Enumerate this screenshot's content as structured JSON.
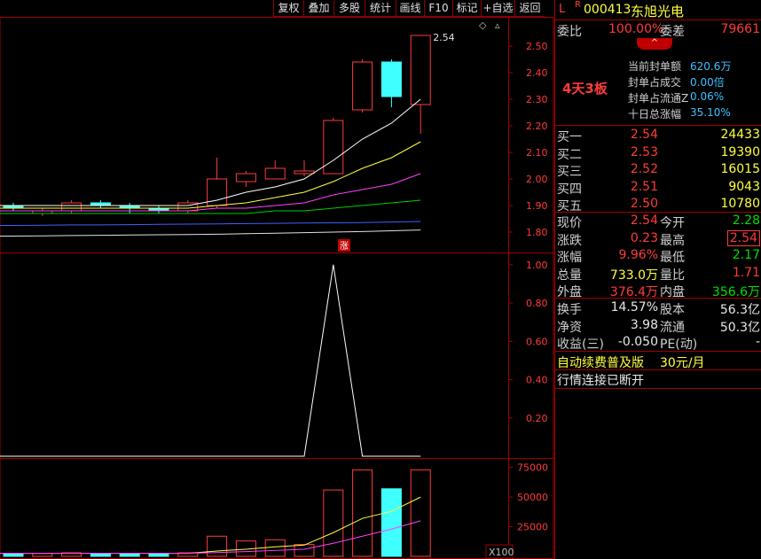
{
  "toolbar": {
    "items": [
      "复权",
      "叠加",
      "多股",
      "统计",
      "画线",
      "F10",
      "标记",
      "+自选",
      "返回"
    ]
  },
  "stock": {
    "flag1": "L",
    "flag2": "R",
    "code": "000413",
    "name": "东旭光电"
  },
  "weibi": {
    "label": "委比",
    "value": "100.00%",
    "label2": "委差",
    "value2": "79661"
  },
  "seal": {
    "badge": "4天3板",
    "rows": [
      {
        "label": "当前封单额",
        "value": "620.6万"
      },
      {
        "label": "封单占成交",
        "value": "0.00倍"
      },
      {
        "label": "封单占流通Z",
        "value": "0.06%"
      },
      {
        "label": "十日总涨幅",
        "value": "35.10%"
      }
    ]
  },
  "bids": [
    {
      "label": "买一",
      "price": "2.54",
      "vol": "24433"
    },
    {
      "label": "买二",
      "price": "2.53",
      "vol": "19390"
    },
    {
      "label": "买三",
      "price": "2.52",
      "vol": "16015"
    },
    {
      "label": "买四",
      "price": "2.51",
      "vol": "9043"
    },
    {
      "label": "买五",
      "price": "2.50",
      "vol": "10780"
    }
  ],
  "quote": [
    {
      "l1": "现价",
      "v1": "2.54",
      "c1": "red",
      "l2": "今开",
      "v2": "2.28",
      "c2": "green"
    },
    {
      "l1": "涨跌",
      "v1": "0.23",
      "c1": "red",
      "l2": "最高",
      "v2": "2.54",
      "c2": "red"
    },
    {
      "l1": "涨幅",
      "v1": "9.96%",
      "c1": "red",
      "l2": "最低",
      "v2": "2.17",
      "c2": "green"
    },
    {
      "l1": "总量",
      "v1": "733.0万",
      "c1": "yellow",
      "l2": "量比",
      "v2": "1.71",
      "c2": "red"
    },
    {
      "l1": "外盘",
      "v1": "376.4万",
      "c1": "red",
      "l2": "内盘",
      "v2": "356.6万",
      "c2": "green"
    }
  ],
  "fund": [
    {
      "l1": "换手",
      "v1": "14.57%",
      "l2": "股本",
      "v2": "56.3亿"
    },
    {
      "l1": "净资",
      "v1": "3.98",
      "l2": "流通",
      "v2": "50.3亿"
    },
    {
      "l1": "收益(三)",
      "v1": "-0.050",
      "l2": "PE(动)",
      "v2": "-"
    }
  ],
  "promo": {
    "text": "自动续费普及版",
    "price": "30元/月"
  },
  "status": {
    "text": "行情连接已断开"
  },
  "chart_labels": {
    "price_high": "2.54",
    "limit_up": "涨",
    "vol_unit": "X100"
  },
  "chart_data": [
    {
      "type": "candlestick",
      "ylim": [
        1.75,
        2.58
      ],
      "yticks": [
        "2.50",
        "2.40",
        "2.30",
        "2.20",
        "2.10",
        "2.00",
        "1.90",
        "1.80"
      ],
      "candles": [
        {
          "o": 1.9,
          "c": 1.89,
          "h": 1.91,
          "l": 1.88
        },
        {
          "o": 1.87,
          "c": 1.88,
          "h": 1.89,
          "l": 1.86
        },
        {
          "o": 1.88,
          "c": 1.91,
          "h": 1.92,
          "l": 1.87
        },
        {
          "o": 1.91,
          "c": 1.9,
          "h": 1.92,
          "l": 1.89
        },
        {
          "o": 1.9,
          "c": 1.89,
          "h": 1.91,
          "l": 1.87
        },
        {
          "o": 1.89,
          "c": 1.88,
          "h": 1.9,
          "l": 1.87
        },
        {
          "o": 1.88,
          "c": 1.91,
          "h": 1.92,
          "l": 1.87
        },
        {
          "o": 1.9,
          "c": 2.0,
          "h": 2.08,
          "l": 1.89
        },
        {
          "o": 1.99,
          "c": 2.02,
          "h": 2.03,
          "l": 1.97
        },
        {
          "o": 2.0,
          "c": 2.04,
          "h": 2.07,
          "l": 2.0
        },
        {
          "o": 2.02,
          "c": 2.03,
          "h": 2.07,
          "l": 2.01
        },
        {
          "o": 2.02,
          "c": 2.22,
          "h": 2.23,
          "l": 2.02
        },
        {
          "o": 2.26,
          "c": 2.44,
          "h": 2.45,
          "l": 2.25
        },
        {
          "o": 2.44,
          "c": 2.31,
          "h": 2.45,
          "l": 2.27
        },
        {
          "o": 2.28,
          "c": 2.54,
          "h": 2.54,
          "l": 2.17
        }
      ],
      "ma": [
        {
          "color": "#ffffff",
          "values": [
            1.9,
            1.9,
            1.9,
            1.9,
            1.9,
            1.9,
            1.9,
            1.92,
            1.95,
            1.97,
            2.0,
            2.07,
            2.15,
            2.21,
            2.3
          ]
        },
        {
          "color": "#ffff40",
          "values": [
            1.89,
            1.89,
            1.89,
            1.89,
            1.89,
            1.89,
            1.89,
            1.9,
            1.91,
            1.93,
            1.95,
            1.99,
            2.04,
            2.08,
            2.14
          ]
        },
        {
          "color": "#ff40ff",
          "values": [
            1.88,
            1.88,
            1.88,
            1.88,
            1.88,
            1.88,
            1.88,
            1.89,
            1.89,
            1.9,
            1.91,
            1.94,
            1.96,
            1.98,
            2.02
          ]
        },
        {
          "color": "#00d000",
          "values": [
            1.87,
            1.87,
            1.87,
            1.87,
            1.87,
            1.87,
            1.87,
            1.87,
            1.87,
            1.88,
            1.88,
            1.89,
            1.9,
            1.91,
            1.92
          ]
        },
        {
          "color": "#4060ff",
          "values": [
            1.825,
            1.826,
            1.827,
            1.827,
            1.828,
            1.829,
            1.83,
            1.831,
            1.832,
            1.833,
            1.834,
            1.835,
            1.836,
            1.838,
            1.84
          ]
        },
        {
          "color": "#e0e0e0",
          "values": [
            1.785,
            1.786,
            1.787,
            1.788,
            1.789,
            1.79,
            1.791,
            1.792,
            1.794,
            1.796,
            1.798,
            1.8,
            1.802,
            1.805,
            1.808
          ]
        }
      ]
    },
    {
      "type": "line",
      "ylim": [
        0,
        1.05
      ],
      "yticks": [
        "1.00",
        "0.80",
        "0.60",
        "0.40",
        "0.20"
      ],
      "values": [
        0,
        0,
        0,
        0,
        0,
        0,
        0,
        0,
        0,
        0,
        0,
        1,
        0,
        0,
        0
      ]
    },
    {
      "type": "bar",
      "ylim": [
        0,
        80000
      ],
      "yticks": [
        "75000",
        "50000",
        "25000"
      ],
      "values": [
        2500,
        2500,
        3000,
        2000,
        2500,
        2000,
        3000,
        17000,
        13000,
        14000,
        10000,
        56000,
        73000,
        57000,
        73000
      ],
      "ma": [
        {
          "color": "#ffff40",
          "values": [
            2500,
            2500,
            2500,
            2500,
            2500,
            2500,
            2500,
            4500,
            6000,
            8000,
            9500,
            20000,
            32000,
            38000,
            50000
          ]
        },
        {
          "color": "#ff40ff",
          "values": [
            2600,
            2600,
            2600,
            2600,
            2600,
            2600,
            2600,
            3200,
            4000,
            5000,
            6000,
            11000,
            17000,
            23000,
            30000
          ]
        }
      ]
    }
  ]
}
